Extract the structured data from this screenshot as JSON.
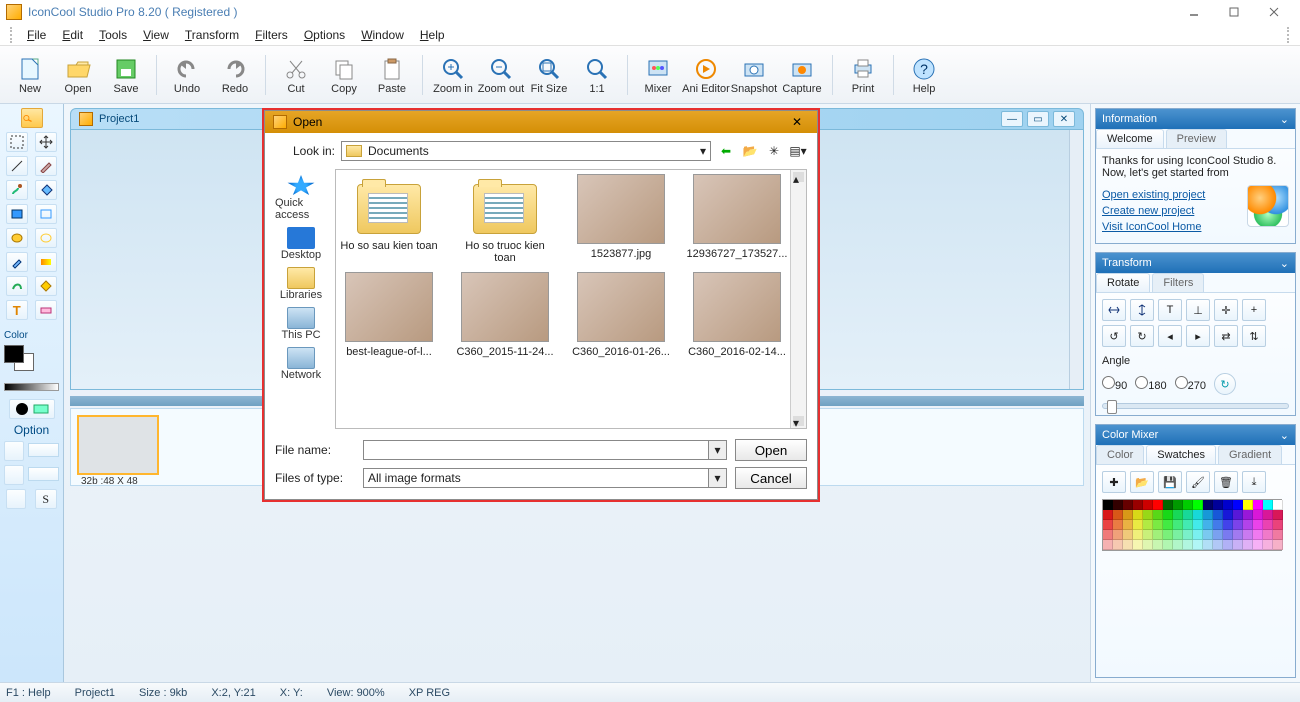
{
  "title": "IconCool Studio Pro 8.20 ( Registered )",
  "menus": [
    "File",
    "Edit",
    "Tools",
    "View",
    "Transform",
    "Filters",
    "Options",
    "Window",
    "Help"
  ],
  "toolbar": [
    {
      "id": "new",
      "label": "New"
    },
    {
      "id": "open",
      "label": "Open"
    },
    {
      "id": "save",
      "label": "Save"
    },
    {
      "sep": true
    },
    {
      "id": "undo",
      "label": "Undo"
    },
    {
      "id": "redo",
      "label": "Redo"
    },
    {
      "sep": true
    },
    {
      "id": "cut",
      "label": "Cut"
    },
    {
      "id": "copy",
      "label": "Copy"
    },
    {
      "id": "paste",
      "label": "Paste"
    },
    {
      "sep": true
    },
    {
      "id": "zoomin",
      "label": "Zoom in"
    },
    {
      "id": "zoomout",
      "label": "Zoom out"
    },
    {
      "id": "fit",
      "label": "Fit Size"
    },
    {
      "id": "oneone",
      "label": "1:1"
    },
    {
      "sep": true
    },
    {
      "id": "mixer",
      "label": "Mixer"
    },
    {
      "id": "anieditor",
      "label": "Ani Editor"
    },
    {
      "id": "snapshot",
      "label": "Snapshot"
    },
    {
      "id": "capture",
      "label": "Capture"
    },
    {
      "sep": true
    },
    {
      "id": "print",
      "label": "Print"
    },
    {
      "sep": true
    },
    {
      "id": "help",
      "label": "Help"
    }
  ],
  "project_title": "Project1",
  "thumb_label": "32b :48 X 48",
  "left_panel": {
    "color_title": "Color",
    "option_title": "Option"
  },
  "info_panel": {
    "title": "Information",
    "tabs": [
      "Welcome",
      "Preview"
    ],
    "welcome_text": "Thanks for using IconCool Studio 8. Now, let's get started from",
    "links": [
      "Open existing project",
      "Create new project",
      "Visit IconCool Home"
    ]
  },
  "transform_panel": {
    "title": "Transform",
    "tabs": [
      "Rotate",
      "Filters"
    ],
    "angle_label": "Angle",
    "angles": [
      "90",
      "180",
      "270"
    ]
  },
  "mixer_panel": {
    "title": "Color Mixer",
    "tabs": [
      "Color",
      "Swatches",
      "Gradient"
    ]
  },
  "status": {
    "help": "F1 : Help",
    "proj": "Project1",
    "size": "Size : 9kb",
    "pos1": "X:2, Y:21",
    "pos2": "X: Y:",
    "view": "View: 900%",
    "reg": "XP REG"
  },
  "dialog": {
    "title": "Open",
    "lookin_label": "Look in:",
    "lookin_value": "Documents",
    "places": [
      "Quick access",
      "Desktop",
      "Libraries",
      "This PC",
      "Network"
    ],
    "row1": [
      {
        "name": "Ho so sau kien toan",
        "type": "folder"
      },
      {
        "name": "Ho so truoc kien toan",
        "type": "folder"
      },
      {
        "name": "1523877.jpg",
        "type": "img"
      },
      {
        "name": "12936727_173527...",
        "type": "img"
      }
    ],
    "row2": [
      {
        "name": "best-league-of-l...",
        "type": "img"
      },
      {
        "name": "C360_2015-11-24...",
        "type": "img"
      },
      {
        "name": "C360_2016-01-26...",
        "type": "img"
      },
      {
        "name": "C360_2016-02-14...",
        "type": "img"
      }
    ],
    "filename_label": "File name:",
    "filesoftype_label": "Files of type:",
    "filesoftype_value": "All image formats",
    "open_btn": "Open",
    "cancel_btn": "Cancel"
  }
}
